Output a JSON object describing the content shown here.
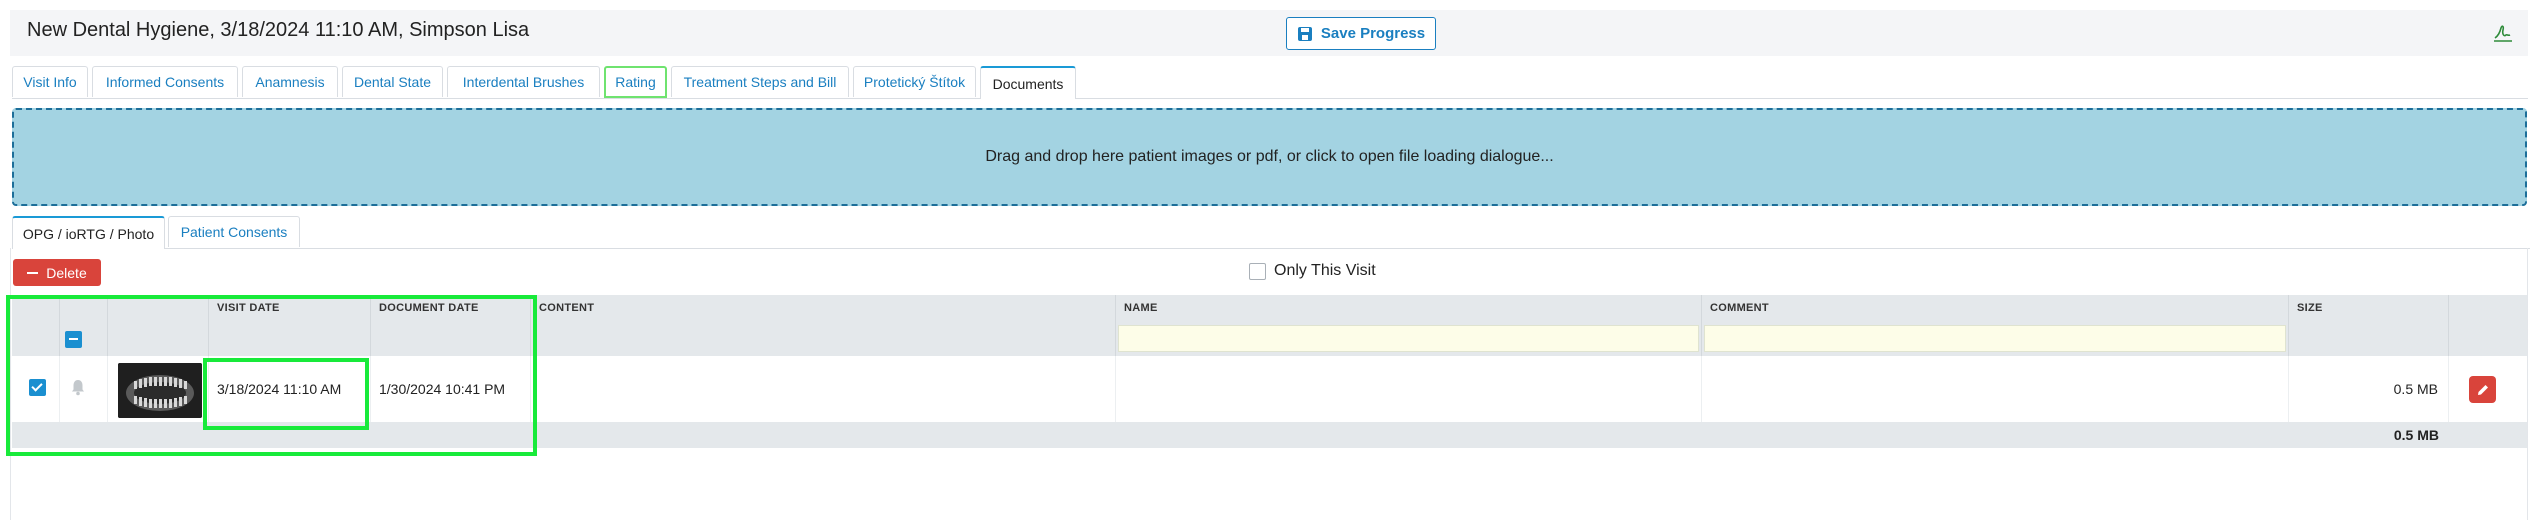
{
  "header": {
    "title": "New Dental Hygiene, 3/18/2024 11:10 AM, Simpson Lisa",
    "save_label": "Save Progress",
    "sign_icon": "signature-icon"
  },
  "tabs": [
    {
      "label": "Visit Info"
    },
    {
      "label": "Informed Consents"
    },
    {
      "label": "Anamnesis"
    },
    {
      "label": "Dental State"
    },
    {
      "label": "Interdental Brushes"
    },
    {
      "label": "Rating"
    },
    {
      "label": "Treatment Steps and Bill"
    },
    {
      "label": "Protetický Štítok"
    },
    {
      "label": "Documents"
    }
  ],
  "dropzone": {
    "text": "Drag and drop here patient images or pdf, or click to open file loading dialogue..."
  },
  "subtabs": [
    {
      "label": "OPG / ioRTG / Photo"
    },
    {
      "label": "Patient Consents"
    }
  ],
  "toolbar": {
    "delete_label": "Delete",
    "only_visit_label": "Only This Visit"
  },
  "grid": {
    "columns": [
      "VISIT DATE",
      "DOCUMENT DATE",
      "CONTENT",
      "NAME",
      "COMMENT",
      "SIZE"
    ],
    "row": {
      "selected": true,
      "visit_date": "3/18/2024 11:10 AM",
      "document_date": "1/30/2024 10:41 PM",
      "content": "",
      "name": "",
      "comment": "",
      "size": "0.5 MB"
    },
    "total_size": "0.5 MB"
  },
  "colors": {
    "accent": "#1a7fc0",
    "danger": "#d9443b",
    "dropzone": "#a3d3e2",
    "highlight": "#18ea3a"
  }
}
